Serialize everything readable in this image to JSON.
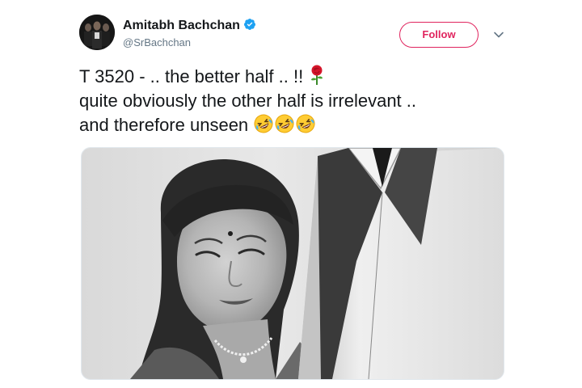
{
  "tweet": {
    "author_name": "Amitabh Bachchan",
    "handle": "@SrBachchan",
    "verified_icon": "verified-badge-icon",
    "follow_label": "Follow",
    "more_icon": "chevron-down-icon",
    "lines": [
      "T 3520 - .. the better half .. !!",
      "quite obviously the other half is irrelevant  ..",
      "and therefore unseen"
    ],
    "line1_emoji": "rose-emoji",
    "line3_emojis": [
      "rolling-on-floor-laughing-emoji",
      "rolling-on-floor-laughing-emoji",
      "rolling-on-floor-laughing-emoji"
    ]
  },
  "colors": {
    "follow_accent": "#e0245e",
    "verified_blue": "#1da1f2",
    "handle_gray": "#657786",
    "text": "#14171a"
  },
  "media": {
    "description": "black-and-white-photo",
    "icon": "photo-icon"
  }
}
